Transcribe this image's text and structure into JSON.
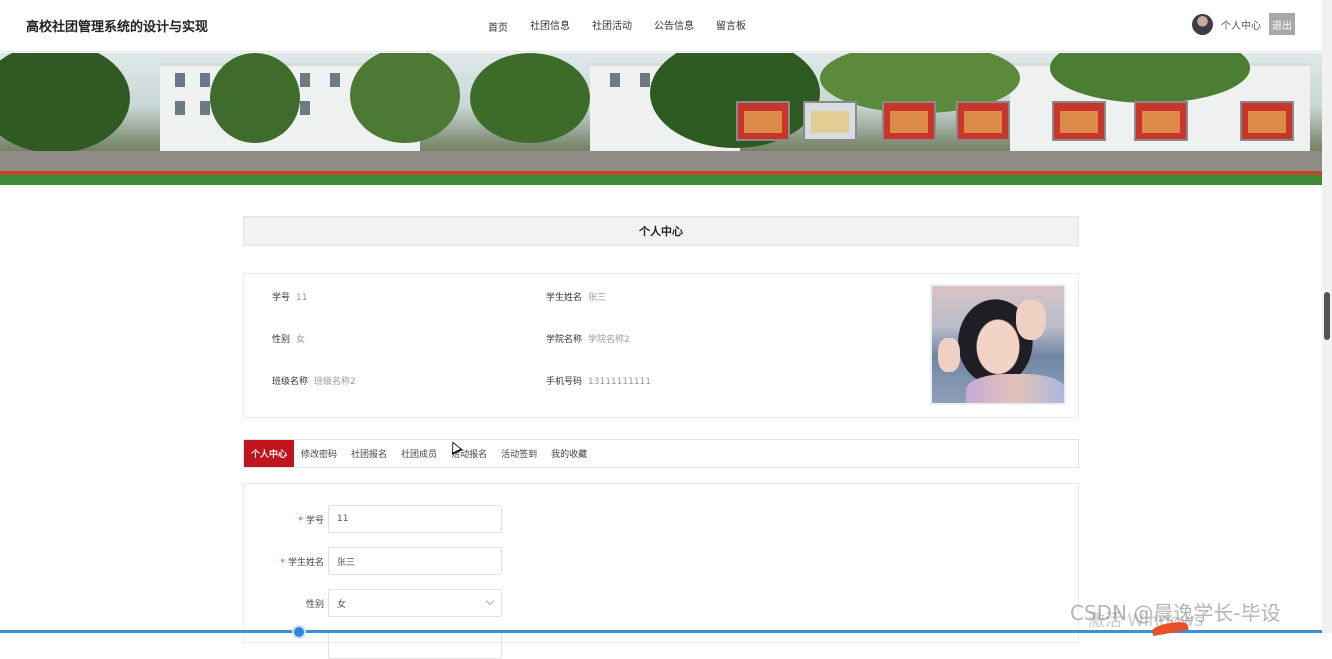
{
  "header": {
    "site_title": "高校社团管理系统的设计与实现",
    "nav": [
      "首页",
      "社团信息",
      "社团活动",
      "公告信息",
      "留言板"
    ],
    "user_center": "个人中心",
    "logout": "退出"
  },
  "section_title": "个人中心",
  "profile": {
    "student_no_label": "学号",
    "student_no": "11",
    "name_label": "学生姓名",
    "name": "张三",
    "gender_label": "性别",
    "gender": "女",
    "college_label": "学院名称",
    "college": "学院名称2",
    "class_label": "班级名称",
    "class": "班级名称2",
    "phone_label": "手机号码",
    "phone": "13111111111"
  },
  "tabs": [
    "个人中心",
    "修改密码",
    "社团报名",
    "社团成员",
    "活动报名",
    "活动签到",
    "我的收藏"
  ],
  "form": {
    "student_no_label": "学号",
    "student_no_value": "11",
    "name_label": "学生姓名",
    "name_value": "张三",
    "gender_label": "性别",
    "gender_value": "女",
    "required_mark": "*"
  },
  "watermark": {
    "csdn": "CSDN @晨逸学长-毕设",
    "windows": "激活 Windows"
  },
  "icons": {
    "avatar": "user-avatar",
    "dropdown": "chevron-down-icon",
    "cursor": "mouse-pointer-icon"
  },
  "colors": {
    "accent": "#c0141f",
    "logout_bg": "#a8a8a8",
    "required": "#e33333"
  }
}
